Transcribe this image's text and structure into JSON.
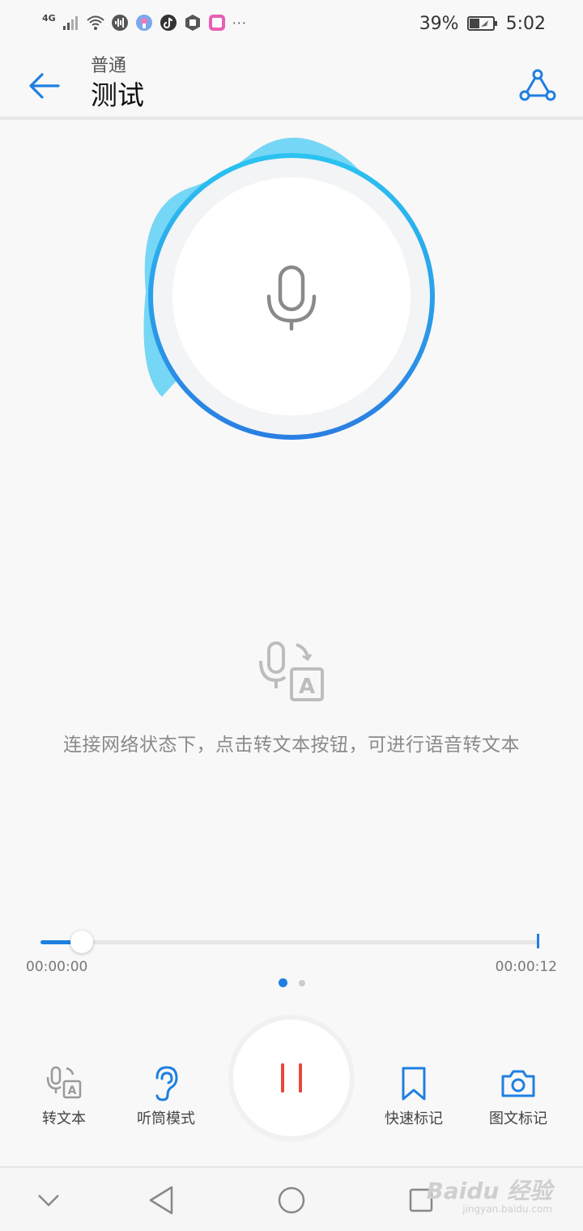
{
  "status_bar": {
    "network": "4G",
    "more": "···",
    "battery_percent": "39%",
    "time": "5:02",
    "icons": [
      "signal-icon",
      "wifi-icon",
      "soundwave-icon",
      "app-icon",
      "tiktok-icon",
      "shield-icon",
      "screen-icon"
    ]
  },
  "header": {
    "subtitle": "普通",
    "title": "测试",
    "back_icon": "arrow-left-icon",
    "share_icon": "share-icon"
  },
  "recorder": {
    "hint": "连接网络状态下，点击转文本按钮，可进行语音转文本",
    "progress_fraction": 0.082,
    "time_start": "00:00:00",
    "time_end": "00:00:12",
    "page_count": 2,
    "active_page": 1
  },
  "controls": {
    "to_text_label": "转文本",
    "earpiece_label": "听筒模式",
    "quick_mark_label": "快速标记",
    "image_mark_label": "图文标记"
  },
  "watermark": {
    "logo": "Baidu 经验",
    "url": "jingyan.baidu.com"
  },
  "colors": {
    "accent": "#1f7fe0",
    "pause_red": "#e5483d",
    "ring_light": "#2bc3f1",
    "ring_dark": "#2a7ee2"
  }
}
